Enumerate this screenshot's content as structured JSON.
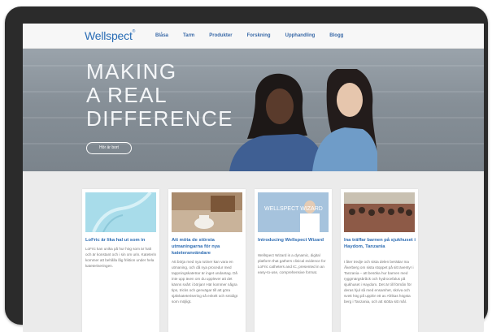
{
  "brand": {
    "logo": "Wellspect",
    "accent": "#2f6db3"
  },
  "nav": {
    "links": [
      "Blåsa",
      "Tarm",
      "Produkter",
      "Forskning",
      "Upphandling",
      "Blogg"
    ]
  },
  "hero": {
    "lines": [
      "MAKING",
      "A REAL",
      "DIFFERENCE"
    ],
    "button": "Hör är bort"
  },
  "cards": [
    {
      "title": "LoFric är lika hal ut som in",
      "text": "LoFric kan unika på hur hög som är halt och är konstant och i sin om urin. Kateterin kommer att behålla låg friktion under hela kateteriseringen.",
      "image_overlay": ""
    },
    {
      "title": "Att möta de största utmaningarna för nya kateteranvändare",
      "text": "Att börja med nya rutiner kan vara en utmaning, och då nya procedur med tappningskatetrar är inget undantag. Då inte upp även om du upplever att det känns svårt i början! Här kommer några tips, tricks och genvägar till att göra självkateterisering så enkelt och smidigt som möjligt.",
      "image_overlay": ""
    },
    {
      "title": "Introducing Wellspect Wizard",
      "text": "Wellspect Wizard is a dynamic, digital platform that gathers clinical evidence for LoFric catheters and IC, presented in an easy-to-use, comprehensive format.",
      "image_overlay": "WELLSPECT WIZARD"
    },
    {
      "title": "Ina träffar barnen på sjukhuset i Haydom, Tanzania",
      "text": "I åter tredje och sista delen berättar Ina Åkerberg om sista stoppet på sitt äventyr i Tanzania – att besöka hur barnen med ryggmärgsbråck och hydrocefalus på sjukhuset i Haydom. Det är till förmån för deras hjul så med ensamhet, skriva och svett hög på upplör ett av Afrikas högsta berg i Tanzania, och att stötta sitt mål.",
      "image_overlay": ""
    }
  ]
}
